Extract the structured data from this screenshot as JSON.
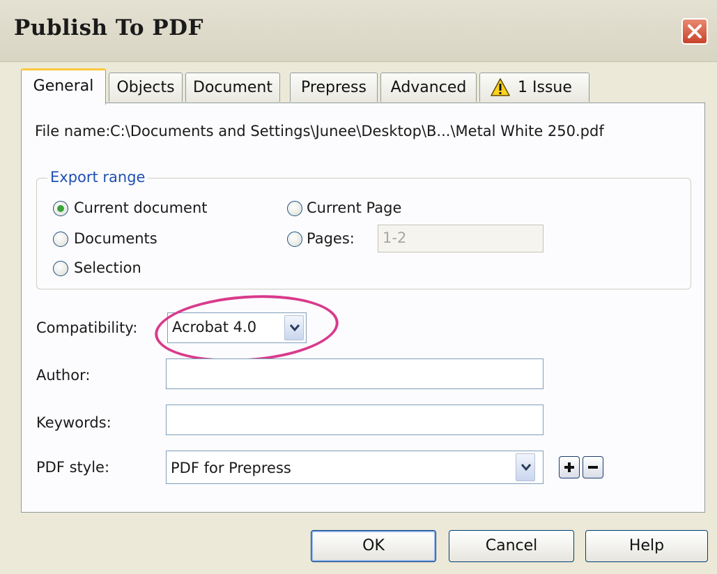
{
  "window": {
    "title": "Publish To PDF"
  },
  "tabs": [
    {
      "label": "General"
    },
    {
      "label": "Objects"
    },
    {
      "label": "Document"
    },
    {
      "label": "Prepress"
    },
    {
      "label": "Advanced"
    },
    {
      "label": "1 Issue",
      "icon": "warning-icon"
    }
  ],
  "general": {
    "file_name_label": "File name:",
    "file_name_value": "C:\\Documents and Settings\\Junee\\Desktop\\B...\\Metal White 250.pdf",
    "export_range": {
      "title": "Export range",
      "options": [
        {
          "label": "Current document",
          "selected": true
        },
        {
          "label": "Documents",
          "selected": false
        },
        {
          "label": "Selection",
          "selected": false
        },
        {
          "label": "Current Page",
          "selected": false
        },
        {
          "label": "Pages:",
          "selected": false
        }
      ],
      "pages_value": "1-2"
    },
    "compatibility_label": "Compatibility:",
    "compatibility_value": "Acrobat 4.0",
    "author_label": "Author:",
    "author_value": "",
    "keywords_label": "Keywords:",
    "keywords_value": "",
    "pdf_style_label": "PDF style:",
    "pdf_style_value": "PDF for Prepress"
  },
  "buttons": {
    "ok": "OK",
    "cancel": "Cancel",
    "help": "Help"
  },
  "colors": {
    "highlight_ellipse": "#d93a8c",
    "tab_accent": "#ffc83c",
    "group_title": "#1f4fb3"
  }
}
